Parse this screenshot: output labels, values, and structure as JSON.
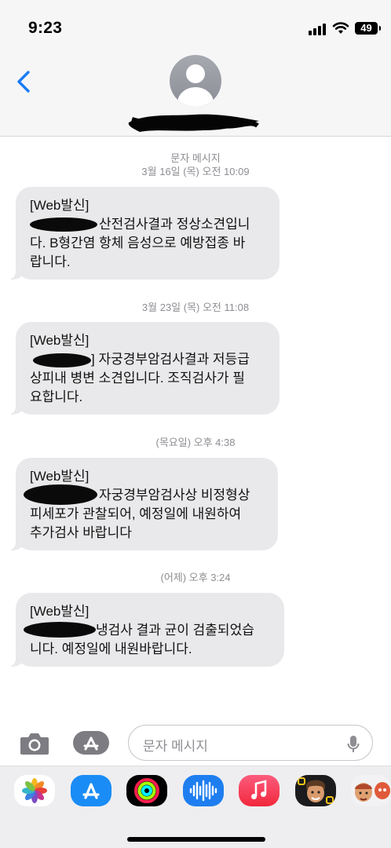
{
  "status_bar": {
    "time": "9:23",
    "battery": "49"
  },
  "header": {
    "back_label": "<"
  },
  "thread": {
    "sender_label": "문자 메시지",
    "messages": [
      {
        "timestamp": "3월 16일 (목) 오전 10:09",
        "lines": [
          "[Web발신]",
          "산전검사결과 정상소견입니",
          "다. B형간염 항체 음성으로 예방접종 바",
          "랍니다."
        ]
      },
      {
        "timestamp": "3월 23일 (목) 오전 11:08",
        "lines": [
          "[Web발신]",
          "] 자궁경부암검사결과 저등급",
          "상피내 병변 소견입니다. 조직검사가 필",
          "요합니다."
        ]
      },
      {
        "timestamp": "(목요일) 오후 4:38",
        "lines": [
          "[Web발신]",
          "자궁경부암검사상 비정형상",
          "피세포가 관찰되어, 예정일에 내원하여",
          "추가검사 바랍니다"
        ]
      },
      {
        "timestamp": "(어제) 오후 3:24",
        "lines": [
          "[Web발신]",
          "냉검사 결과 균이 검출되었습",
          "니다. 예정일에 내원바랍니다."
        ]
      }
    ]
  },
  "input": {
    "placeholder": "문자 메시지"
  },
  "app_drawer": {
    "apps": [
      "photos-app-icon",
      "app-store-app-icon",
      "fitness-app-icon",
      "voice-memos-app-icon",
      "music-app-icon",
      "memoji-app-icon",
      "memoji-sticker-app-icon"
    ]
  },
  "colors": {
    "accent": "#1a7cf5",
    "bubble": "#e9e9eb",
    "meta_text": "#8e8e93"
  }
}
